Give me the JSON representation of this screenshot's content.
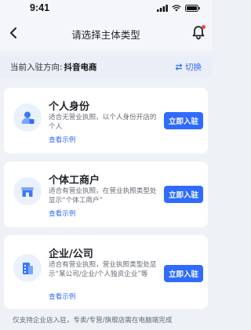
{
  "status_bar": {
    "time": "9:41"
  },
  "nav": {
    "title": "请选择主体类型"
  },
  "direction": {
    "label": "当前入驻方向:",
    "value": "抖音电商",
    "switch_label": "切换"
  },
  "cards": [
    {
      "title": "个人身份",
      "description": "适合无营业执照，以个人身份开店的个人",
      "example_link": "查看示例",
      "button": "立即入驻",
      "icon": "person-icon"
    },
    {
      "title": "个体工商户",
      "description": "适合有营业执照，在营业执照类型处显示“个体工商户”",
      "example_link": "查看示例",
      "button": "立即入驻",
      "icon": "shop-icon"
    },
    {
      "title": "企业/公司",
      "description": "适合有营业执照，营业执照类型处显示“某公司/企业/个人独资企业”等",
      "example_link": "查看示例",
      "button": "立即入驻",
      "icon": "company-icon"
    }
  ],
  "footer": {
    "note": "仅支持企业店入驻，专卖/专营/旗舰店需在电脑端完成"
  },
  "colors": {
    "accent": "#2f6bff",
    "icon_bg": "#eaf1fd",
    "notification_dot": "#f5463d"
  }
}
